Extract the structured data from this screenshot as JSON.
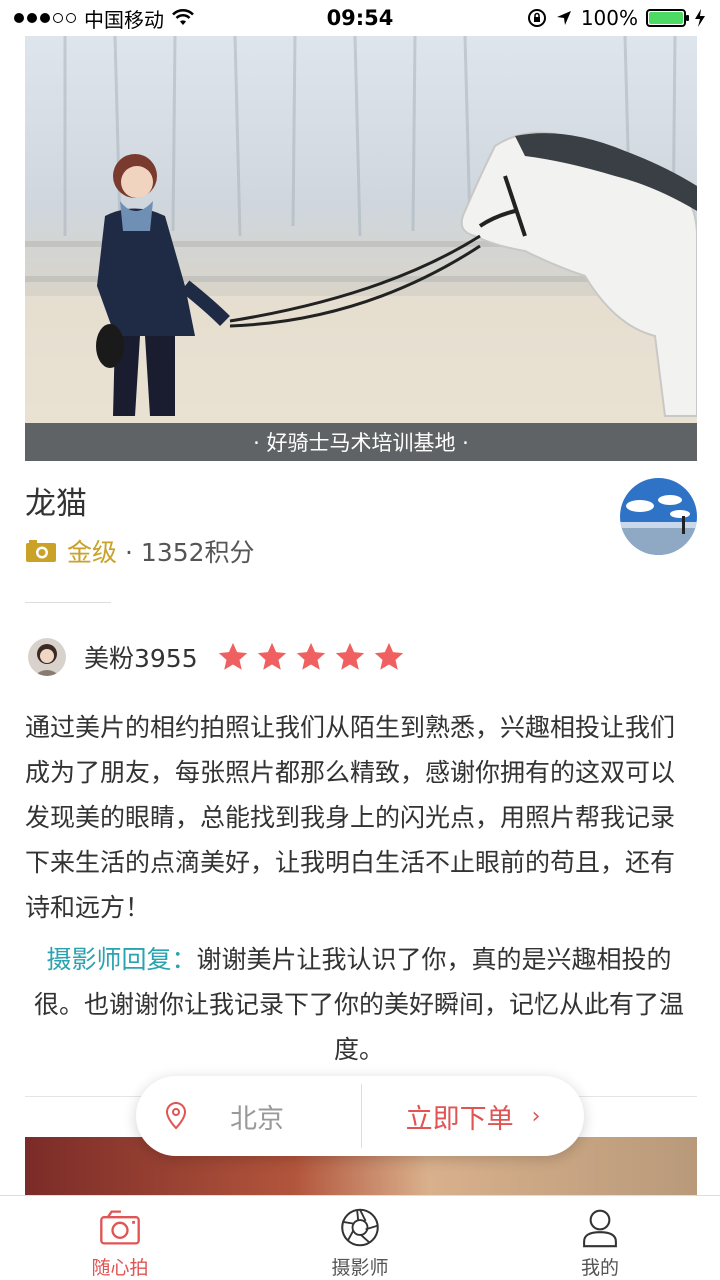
{
  "status_bar": {
    "carrier": "中国移动",
    "time": "09:54",
    "battery": "100%",
    "battery_level": 1.0
  },
  "hero": {
    "caption": "· 好骑士马术培训基地 ·"
  },
  "profile": {
    "name": "龙猫",
    "level": "金级",
    "points": "· 1352积分"
  },
  "review": {
    "reviewer": "美粉3955",
    "rating": 5,
    "text": "通过美片的相约拍照让我们从陌生到熟悉，兴趣相投让我们成为了朋友，每张照片都那么精致，感谢你拥有的这双可以发现美的眼睛，总能找到我身上的闪光点，用照片帮我记录下来生活的点滴美好，让我明白生活不止眼前的苟且，还有诗和远方！",
    "reply_label": "摄影师回复：",
    "reply_text": "谢谢美片让我认识了你，真的是兴趣相投的很。也谢谢你让我记录下了你的美好瞬间，记忆从此有了温度。"
  },
  "action_bar": {
    "location": "北京",
    "order": "立即下单"
  },
  "tabs": [
    {
      "label": "随心拍",
      "icon": "camera-icon",
      "active": true
    },
    {
      "label": "摄影师",
      "icon": "aperture-icon",
      "active": false
    },
    {
      "label": "我的",
      "icon": "user-icon",
      "active": false
    }
  ],
  "colors": {
    "accent": "#e05454",
    "gold": "#c9a227",
    "reply": "#2aa3b1"
  }
}
